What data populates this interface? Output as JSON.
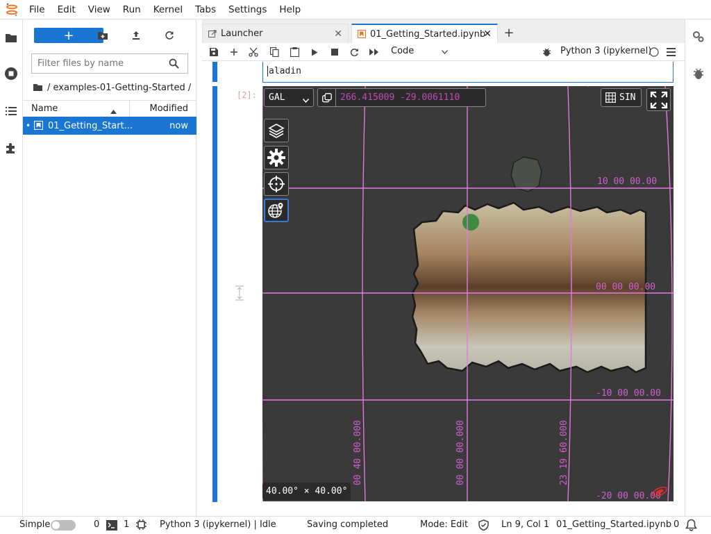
{
  "menubar": {
    "items": [
      "File",
      "Edit",
      "View",
      "Run",
      "Kernel",
      "Tabs",
      "Settings",
      "Help"
    ]
  },
  "file_panel": {
    "new_button": "+",
    "filter_placeholder": "Filter files by name",
    "breadcrumb": "/ examples-01-Getting-Started /",
    "columns": {
      "name": "Name",
      "modified": "Modified"
    },
    "files": [
      {
        "name": "01_Getting_Start...",
        "modified": "now",
        "running": "•"
      }
    ]
  },
  "tabs": [
    {
      "label": "Launcher",
      "close": "✕"
    },
    {
      "label": "01_Getting_Started.ipynb",
      "close": "✕"
    }
  ],
  "add_tab": "+",
  "notebook_toolbar": {
    "cell_type": "Code",
    "kernel": "Python 3 (ipykernel)"
  },
  "cells": {
    "code_text": "aladin",
    "output_prompt": "[2]:"
  },
  "aladin": {
    "frame": "GAL",
    "coordinates": "266.415009 -29.0061110",
    "projection": "SIN",
    "fov": "40.00° × 40.00°",
    "grid_labels": {
      "dec_top": "10 00 00.00",
      "dec_center": "00 00 00.00",
      "dec_mid": "-10 00 00.00",
      "dec_bottom": "-20 00 00.00",
      "ra_left": "00 40 00.000",
      "ra_center": "00 00 00.000",
      "ra_right": "23 19 60.000"
    },
    "colors": {
      "background": "#3a3a3a",
      "grid": "#e27ae2",
      "grid_label": "#d05fd0"
    }
  },
  "statusbar": {
    "mode_label": "Simple",
    "terminals_count": "0",
    "kernels_count": "1",
    "kernel_status": "Python 3 (ipykernel) | Idle",
    "save_status": "Saving completed",
    "mode": "Mode: Edit",
    "cursor": "Ln 9, Col 1",
    "filename": "01_Getting_Started.ipynb",
    "notifications": "0"
  },
  "icons": {
    "leftbar": [
      "folder-icon",
      "running-icon",
      "toc-icon",
      "extension-icon"
    ],
    "rightbar": [
      "property-inspector-icon",
      "debugger-icon"
    ]
  }
}
